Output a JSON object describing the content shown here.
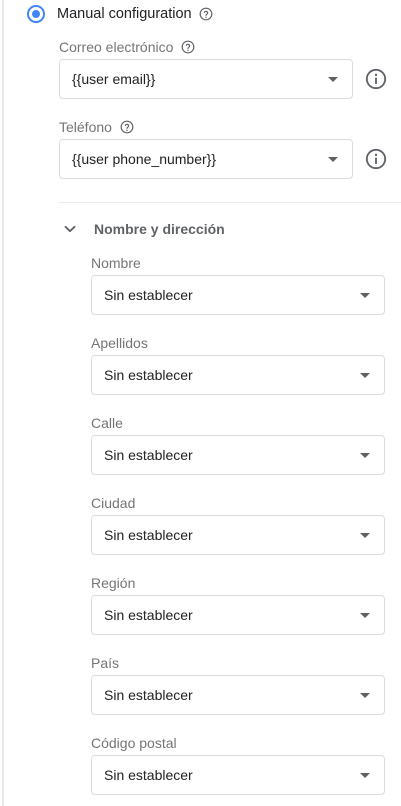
{
  "manual_config": {
    "label": "Manual configuration",
    "selected": true
  },
  "email": {
    "label": "Correo electrónico",
    "value": "{{user email}}"
  },
  "phone": {
    "label": "Teléfono",
    "value": "{{user phone_number}}"
  },
  "name_address": {
    "title": "Nombre y dirección",
    "expanded": true,
    "fields": [
      {
        "label": "Nombre",
        "value": "Sin establecer"
      },
      {
        "label": "Apellidos",
        "value": "Sin establecer"
      },
      {
        "label": "Calle",
        "value": "Sin establecer"
      },
      {
        "label": "Ciudad",
        "value": "Sin establecer"
      },
      {
        "label": "Región",
        "value": "Sin establecer"
      },
      {
        "label": "País",
        "value": "Sin establecer"
      },
      {
        "label": "Código postal",
        "value": "Sin establecer"
      }
    ]
  },
  "colors": {
    "accent": "#4285f4",
    "border": "#dadce0",
    "label": "#757575",
    "icon": "#5f6368"
  },
  "icons": {
    "help": "help-circle-icon",
    "info": "info-circle-icon",
    "caret": "caret-down-icon",
    "chevron": "chevron-down-icon"
  }
}
